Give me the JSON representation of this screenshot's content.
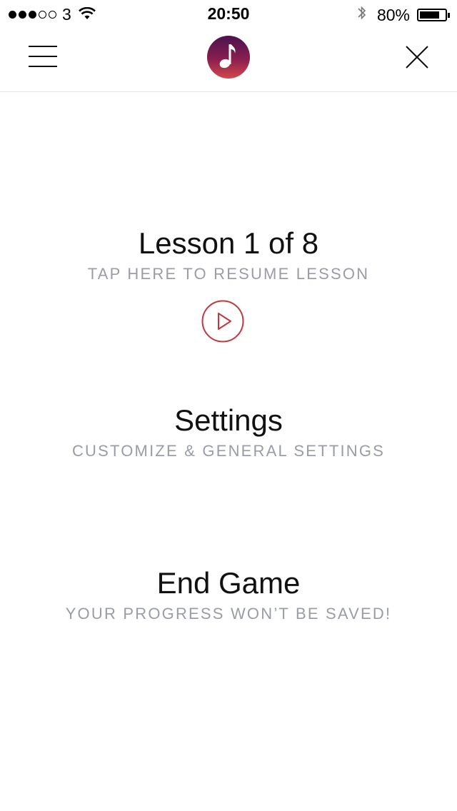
{
  "status_bar": {
    "carrier": "3",
    "time": "20:50",
    "battery_percent": "80%",
    "battery_level": 0.8,
    "signal_bars_filled": 3,
    "signal_bars_total": 5,
    "icons": [
      "wifi-icon",
      "bluetooth-icon",
      "battery-icon"
    ]
  },
  "nav": {
    "menu_icon": "hamburger-menu-icon",
    "logo_icon": "music-note-icon",
    "close_icon": "close-icon",
    "logo_gradient": [
      "#4a1250",
      "#d4464a"
    ]
  },
  "menu": {
    "lesson": {
      "title": "Lesson 1 of 8",
      "subtitle": "TAP HERE TO RESUME LESSON",
      "play_icon": "play-icon"
    },
    "settings": {
      "title": "Settings",
      "subtitle": "CUSTOMIZE & GENERAL SETTINGS"
    },
    "end_game": {
      "title": "End Game",
      "subtitle": "YOUR PROGRESS WON’T BE SAVED!"
    }
  },
  "colors": {
    "accent": "#c0393f",
    "subtitle": "#9a9ca6",
    "divider": "#e3e3e3"
  }
}
